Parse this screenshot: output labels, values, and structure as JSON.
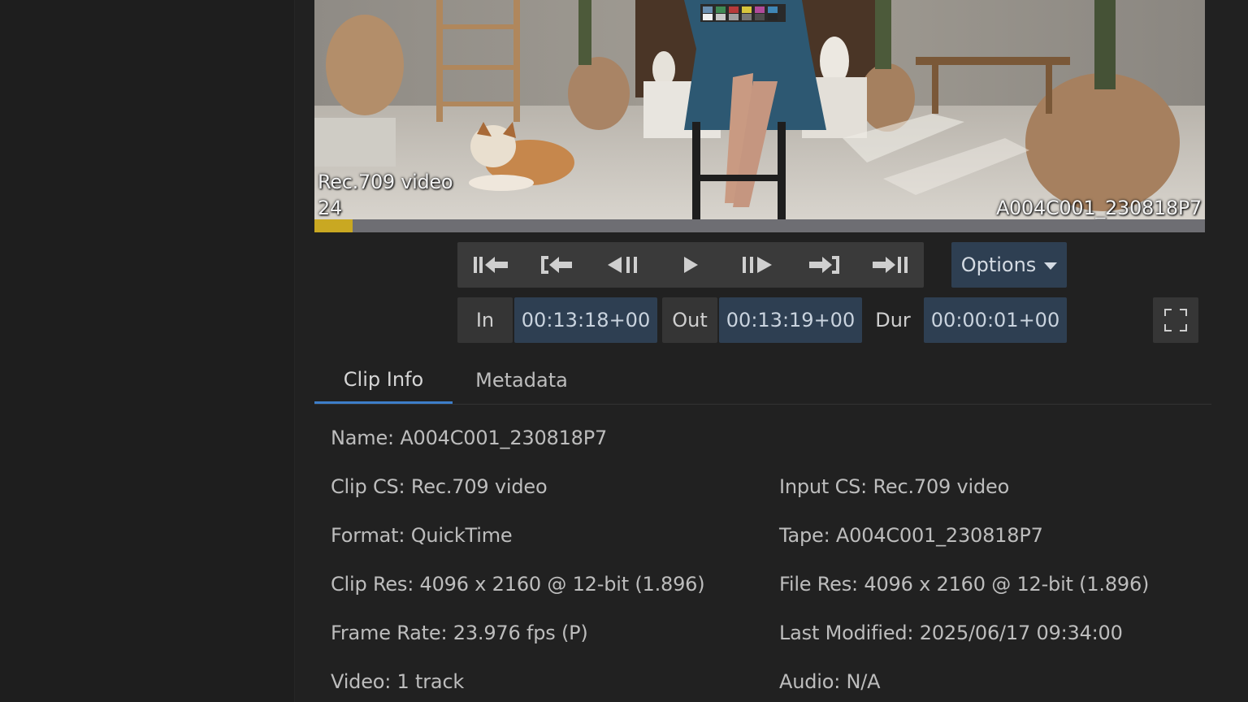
{
  "viewer": {
    "colorspace": "Rec.709 video",
    "frame_rate": "24",
    "clip_name": "A004C001_230818P7",
    "progress": 0.043
  },
  "transport": {
    "buttons": [
      "go-to-start",
      "go-to-in",
      "step-back",
      "play",
      "step-forward",
      "go-to-out",
      "go-to-end"
    ]
  },
  "options": {
    "label": "Options"
  },
  "timecode": {
    "in_label": "In",
    "in_value": "00:13:18+00",
    "out_label": "Out",
    "out_value": "00:13:19+00",
    "dur_label": "Dur",
    "dur_value": "00:00:01+00"
  },
  "tabs": [
    {
      "label": "Clip Info",
      "active": true
    },
    {
      "label": "Metadata",
      "active": false
    }
  ],
  "clip_info": {
    "name": "Name: A004C001_230818P7",
    "clip_cs": "Clip CS: Rec.709 video",
    "input_cs": "Input CS: Rec.709 video",
    "format": "Format: QuickTime",
    "tape": "Tape: A004C001_230818P7",
    "clip_res": "Clip Res: 4096 x 2160 @ 12-bit (1.896)",
    "file_res": "File Res: 4096 x 2160 @ 12-bit (1.896)",
    "frame_rate": "Frame Rate: 23.976 fps (P)",
    "last_modified": "Last Modified: 2025/06/17 09:34:00",
    "video": "Video: 1 track",
    "audio": "Audio: N/A"
  },
  "colors": {
    "accent": "#3d7ec9",
    "scrub_fill": "#c9a822",
    "value_bg": "#2e3f52"
  }
}
